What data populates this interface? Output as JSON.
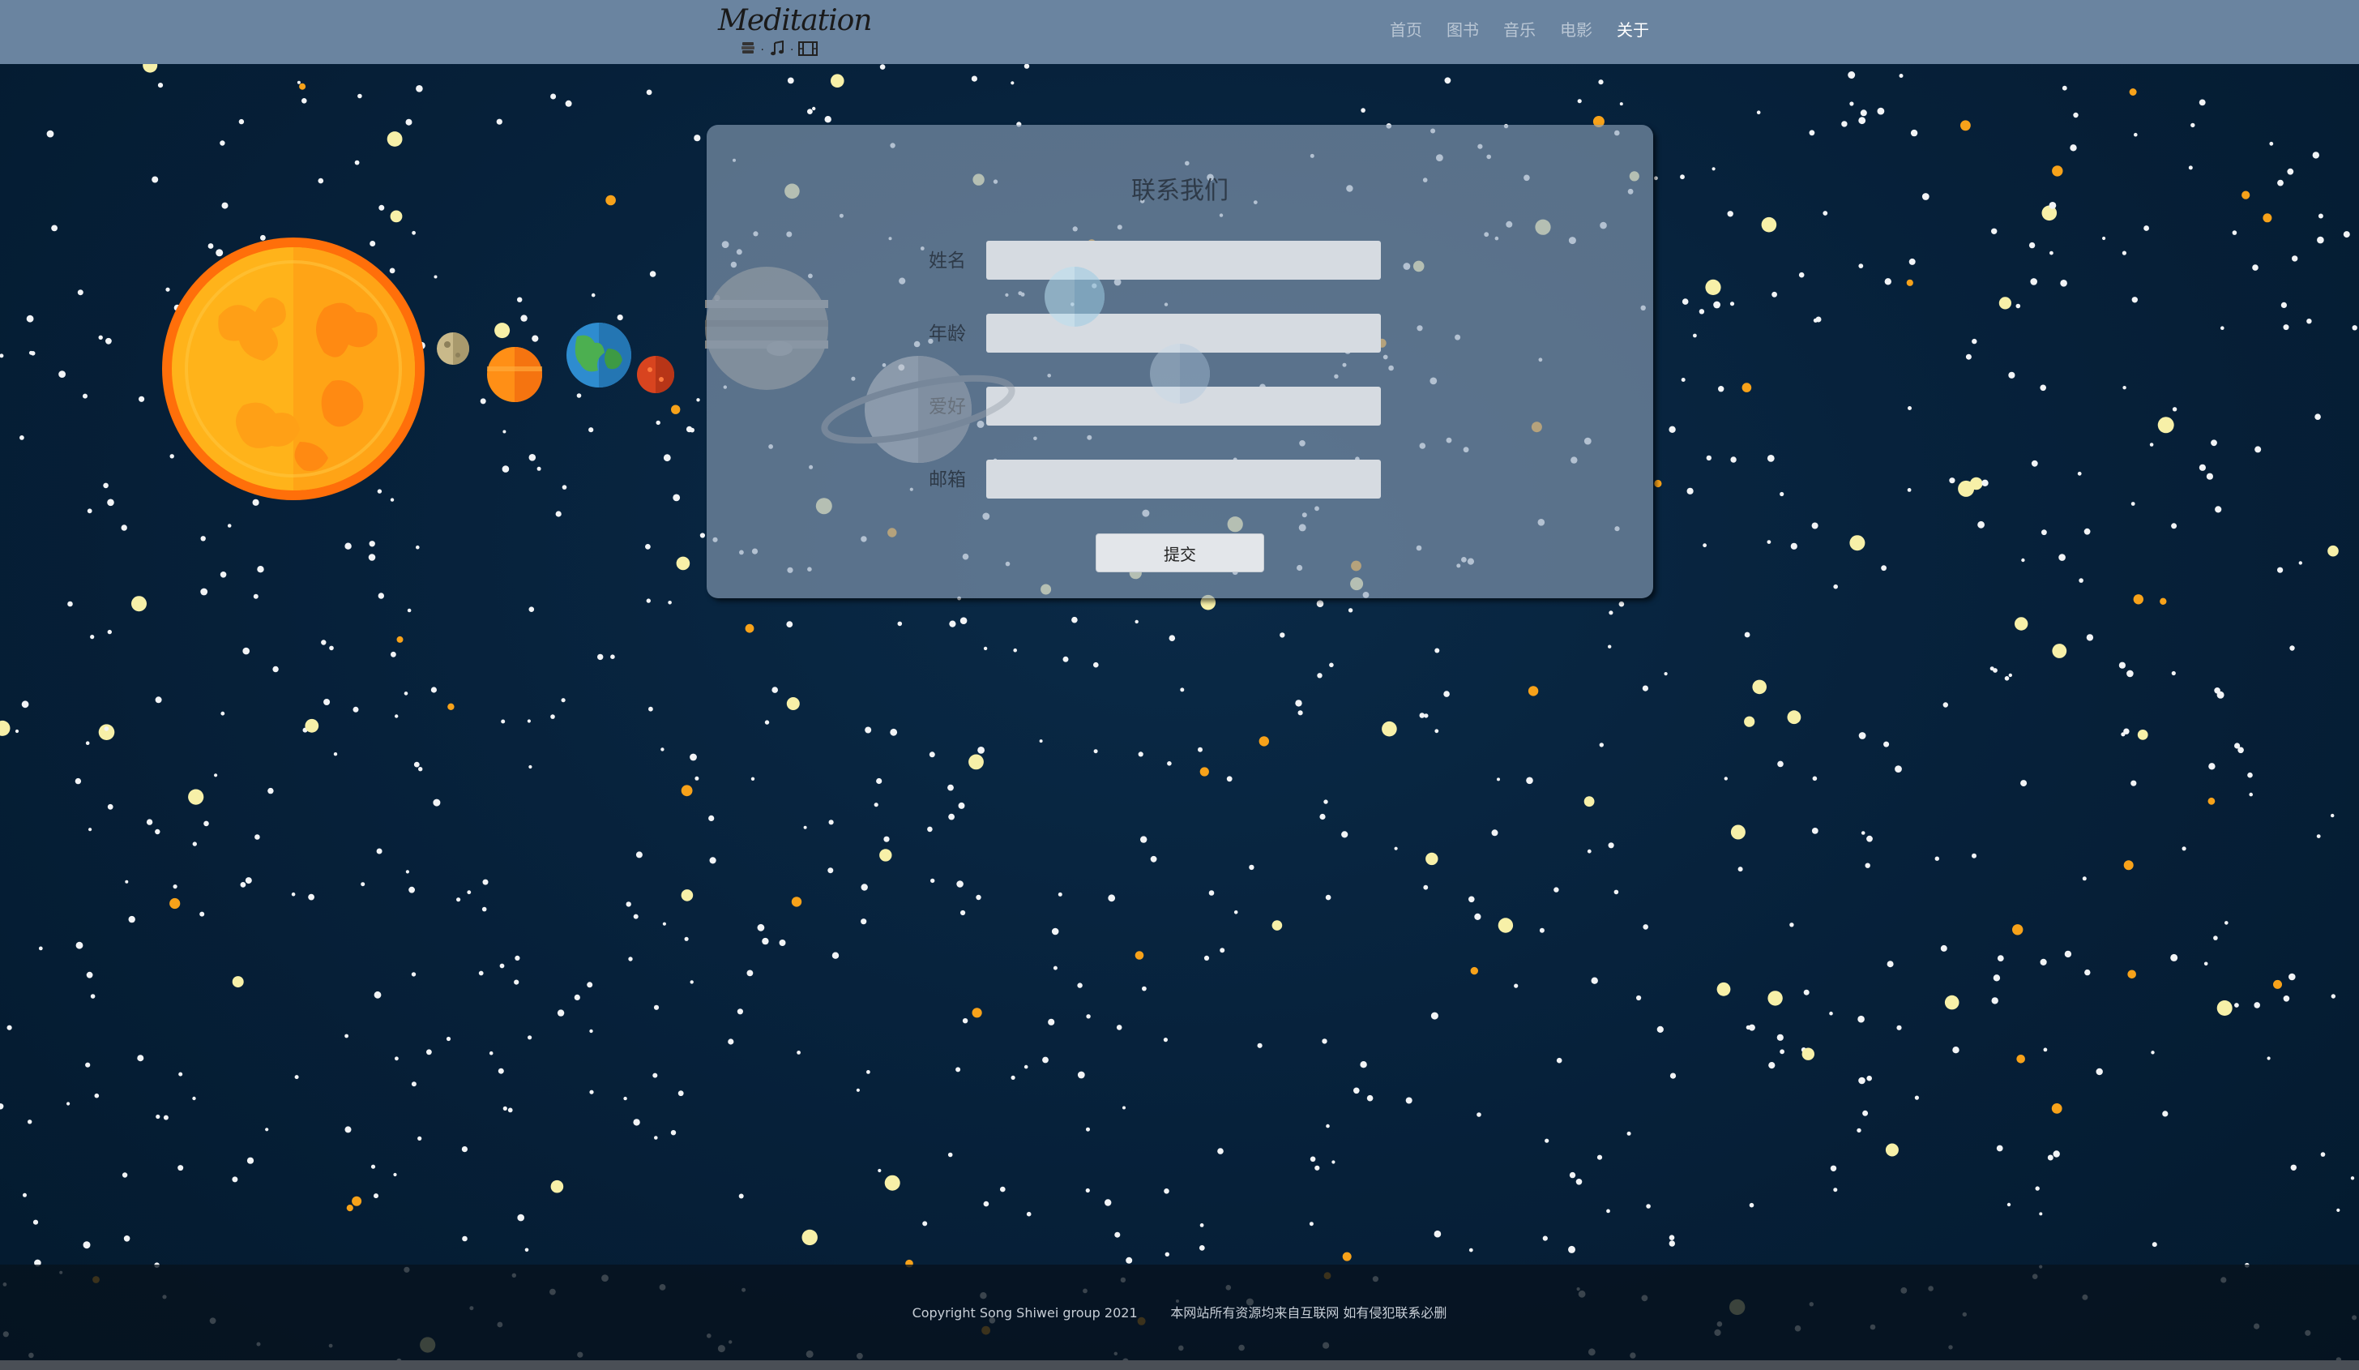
{
  "header": {
    "logo_title": "Meditation",
    "logo_icons": [
      "book-stack-icon",
      "music-note-icon",
      "film-strip-icon"
    ],
    "logo_separator": "·",
    "nav": [
      {
        "label": "首页",
        "active": false
      },
      {
        "label": "图书",
        "active": false
      },
      {
        "label": "音乐",
        "active": false
      },
      {
        "label": "电影",
        "active": false
      },
      {
        "label": "关于",
        "active": true
      }
    ]
  },
  "contact": {
    "title": "联系我们",
    "fields": [
      {
        "label": "姓名",
        "value": "",
        "placeholder": ""
      },
      {
        "label": "年龄",
        "value": "",
        "placeholder": ""
      },
      {
        "label": "爱好",
        "value": "",
        "placeholder": ""
      },
      {
        "label": "邮箱",
        "value": "",
        "placeholder": ""
      }
    ],
    "submit_label": "提交"
  },
  "footer": {
    "copyright": "Copyright Song Shiwei group 2021",
    "notice": "本网站所有资源均来自互联网 如有侵犯联系必删"
  },
  "colors": {
    "header_bg": "#6a84a0",
    "space_bg": "#062039",
    "card_bg": "#8ca2ba",
    "sun": "#ffb31a",
    "sun_rim": "#ff7a0a"
  }
}
